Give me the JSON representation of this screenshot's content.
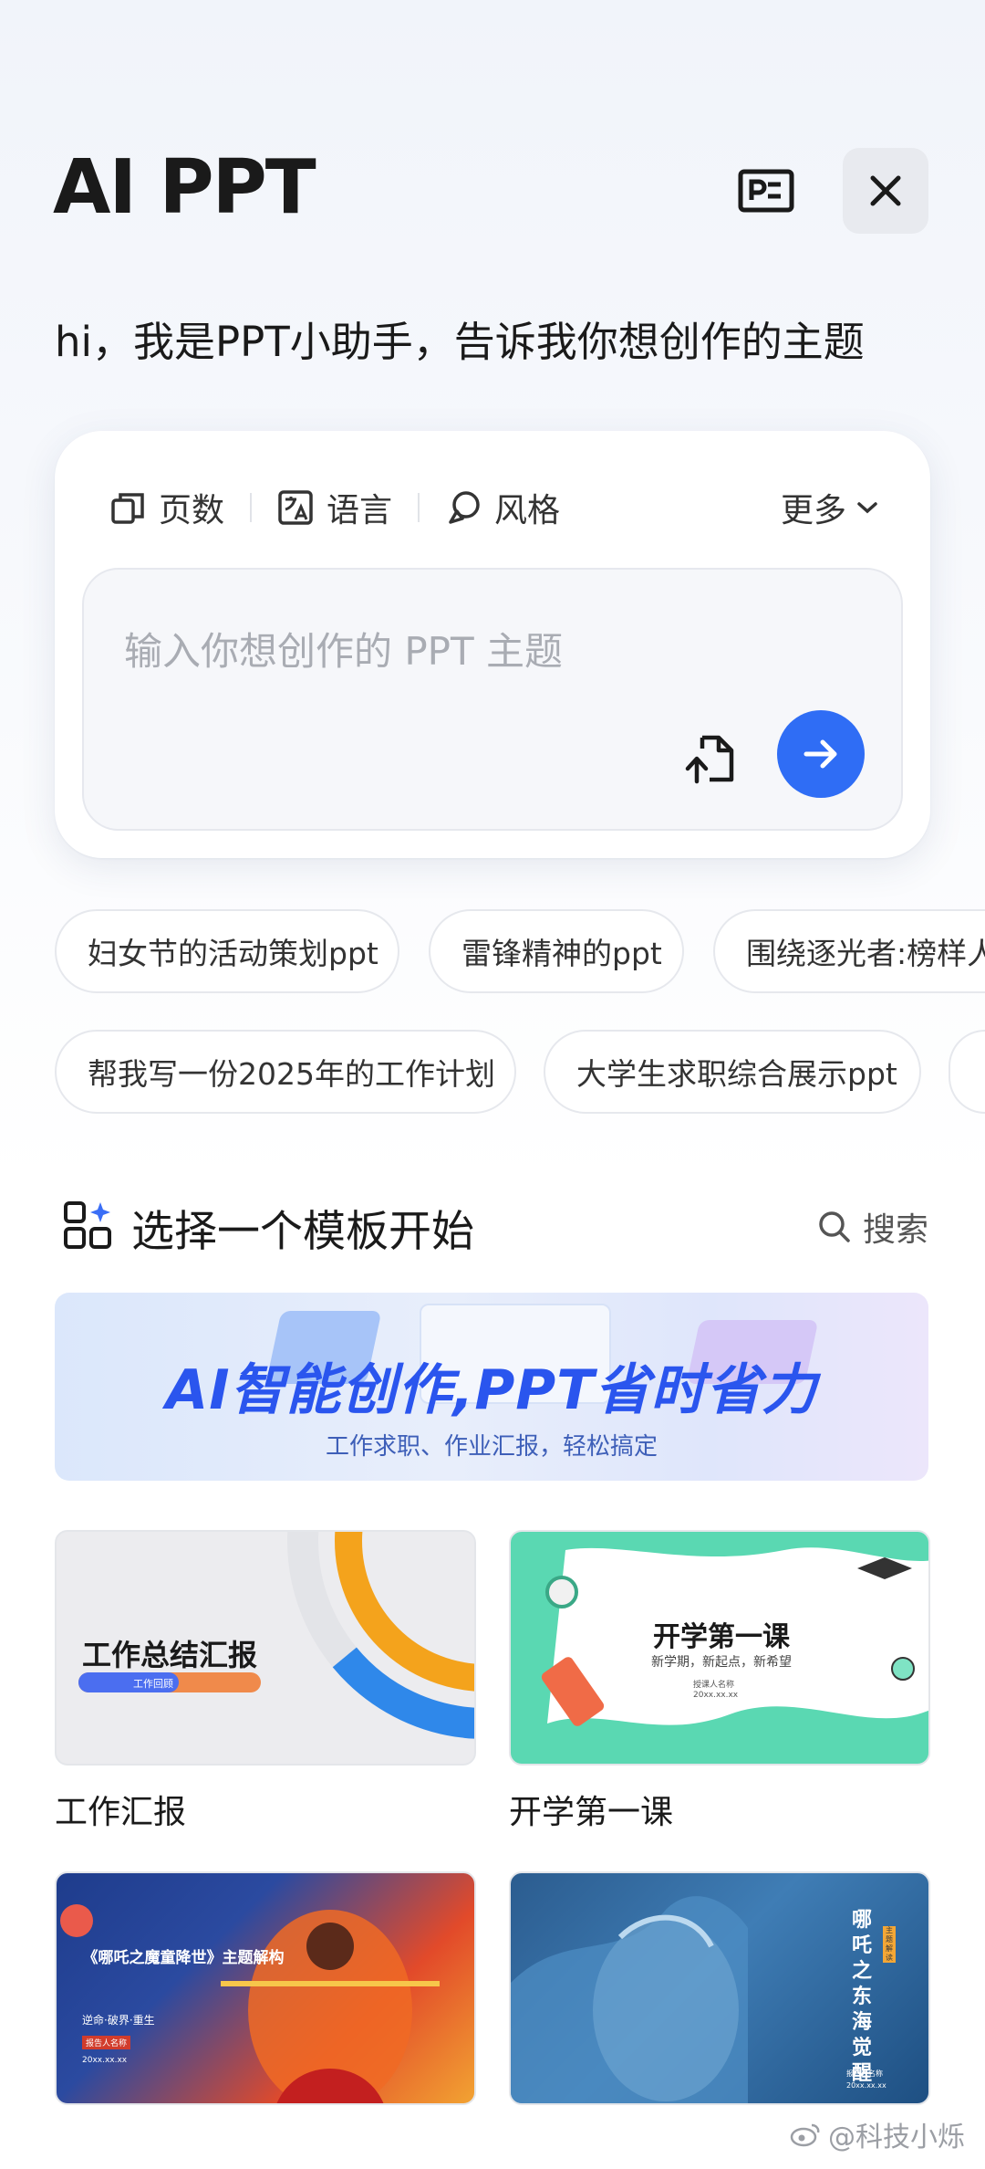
{
  "header": {
    "title": "AI PPT",
    "slides_icon": "slides-icon",
    "close_icon": "close-icon"
  },
  "greeting": "hi，我是PPT小助手，告诉我你想创作的主题",
  "input_card": {
    "options": [
      {
        "label": "页数",
        "icon": "page-count-icon"
      },
      {
        "label": "语言",
        "icon": "translate-icon"
      },
      {
        "label": "风格",
        "icon": "style-icon"
      }
    ],
    "more_label": "更多",
    "placeholder": "输入你想创作的 PPT 主题",
    "upload_icon": "file-upload-icon",
    "send_icon": "arrow-right-icon"
  },
  "suggestions": {
    "row1": [
      "妇女节的活动策划ppt",
      "雷锋精神的ppt",
      "围绕逐光者:榜样人物"
    ],
    "row2": [
      "帮我写一份2025年的工作计划",
      "大学生求职综合展示ppt",
      ""
    ]
  },
  "templates": {
    "section_title": "选择一个模板开始",
    "search_label": "搜索",
    "banner": {
      "headline": "AI智能创作,PPT省时省力",
      "subtitle": "工作求职、作业汇报，轻松搞定"
    },
    "items": [
      {
        "label": "工作汇报",
        "thumb_title": "工作总结汇报",
        "thumb_tag": "工作回顾"
      },
      {
        "label": "开学第一课",
        "thumb_title": "开学第一课",
        "thumb_sub": "新学期，新起点，新希望",
        "thumb_presenter": "授课人名称",
        "thumb_date": "20xx.xx.xx"
      },
      {
        "label": "",
        "thumb_title": "《哪吒之魔童降世》主题解构",
        "thumb_sub": "逆命·破界·重生",
        "thumb_presenter": "报告人名称",
        "thumb_date": "20xx.xx.xx"
      },
      {
        "label": "",
        "thumb_title": "哪吒之东海觉醒",
        "thumb_tag": "主题解读",
        "thumb_presenter": "报告人名称",
        "thumb_date": "20xx.xx.xx"
      }
    ]
  },
  "watermark": "@科技小烁",
  "colors": {
    "accent": "#2f6df5",
    "chip_border": "#e6e8ed",
    "placeholder": "#a9acb3"
  }
}
